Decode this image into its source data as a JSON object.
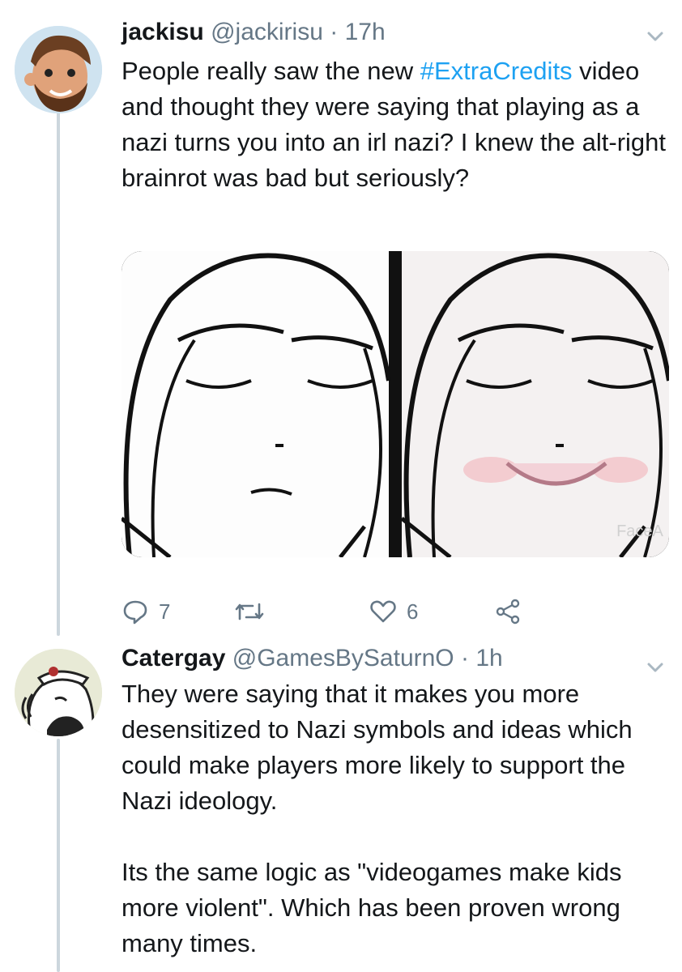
{
  "tweet1": {
    "display_name": "jackisu",
    "handle": "@jackirisu",
    "separator": "·",
    "time": "17h",
    "text_before": "People really saw the new ",
    "hashtag": "#ExtraCredits",
    "text_after": " video and thought they were saying that playing as a nazi turns you into an irl nazi? I knew the alt-right brainrot was bad but seriously?",
    "media_watermark": "FaceA",
    "reply_count": "7",
    "retweet_count": "",
    "like_count": "6",
    "icons": [
      "reply-icon",
      "retweet-icon",
      "like-icon",
      "share-icon",
      "chevron-down-icon"
    ]
  },
  "tweet2": {
    "display_name": "Catergay",
    "handle": "@GamesBySaturnO",
    "separator": "·",
    "time": "1h",
    "paragraphs": [
      "They were saying that it makes you more desensitized to Nazi symbols and ideas which could make players more likely to support the Nazi ideology.",
      "Its the same logic as \"videogames make kids more violent\". Which has been proven wrong many times."
    ]
  },
  "colors": {
    "link": "#1da1f2",
    "muted": "#657786",
    "thread_line": "#ccd6dd",
    "text": "#14171a"
  }
}
